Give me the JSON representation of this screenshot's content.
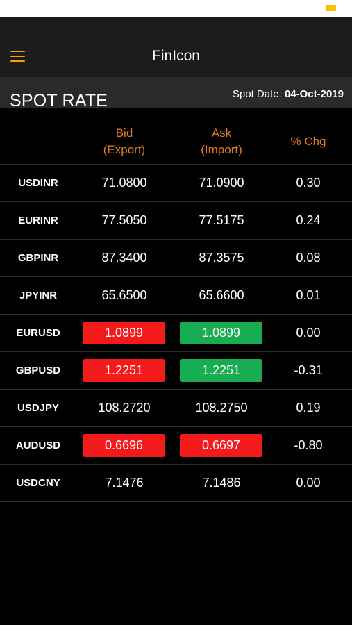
{
  "app": {
    "title": "FinIcon"
  },
  "header": {
    "title": "SPOT RATE",
    "spot_date_label": "Spot Date: ",
    "spot_date_value": "04-Oct-2019"
  },
  "colors": {
    "accent": "#e07b24",
    "up": "#18ad52",
    "down": "#f21a1a",
    "background": "#000000"
  },
  "table": {
    "columns": {
      "bid_line1": "Bid",
      "bid_line2": "(Export)",
      "ask_line1": "Ask",
      "ask_line2": "(Import)",
      "chg": "% Chg"
    },
    "rows": [
      {
        "pair": "USDINR",
        "bid": "71.0800",
        "ask": "71.0900",
        "chg": "0.30",
        "bid_tone": "none",
        "ask_tone": "none"
      },
      {
        "pair": "EURINR",
        "bid": "77.5050",
        "ask": "77.5175",
        "chg": "0.24",
        "bid_tone": "none",
        "ask_tone": "none"
      },
      {
        "pair": "GBPINR",
        "bid": "87.3400",
        "ask": "87.3575",
        "chg": "0.08",
        "bid_tone": "none",
        "ask_tone": "none"
      },
      {
        "pair": "JPYINR",
        "bid": "65.6500",
        "ask": "65.6600",
        "chg": "0.01",
        "bid_tone": "none",
        "ask_tone": "none"
      },
      {
        "pair": "EURUSD",
        "bid": "1.0899",
        "ask": "1.0899",
        "chg": "0.00",
        "bid_tone": "red",
        "ask_tone": "green"
      },
      {
        "pair": "GBPUSD",
        "bid": "1.2251",
        "ask": "1.2251",
        "chg": "-0.31",
        "bid_tone": "red",
        "ask_tone": "green"
      },
      {
        "pair": "USDJPY",
        "bid": "108.2720",
        "ask": "108.2750",
        "chg": "0.19",
        "bid_tone": "none",
        "ask_tone": "none"
      },
      {
        "pair": "AUDUSD",
        "bid": "0.6696",
        "ask": "0.6697",
        "chg": "-0.80",
        "bid_tone": "red",
        "ask_tone": "red"
      },
      {
        "pair": "USDCNY",
        "bid": "7.1476",
        "ask": "7.1486",
        "chg": "0.00",
        "bid_tone": "none",
        "ask_tone": "none"
      }
    ]
  }
}
